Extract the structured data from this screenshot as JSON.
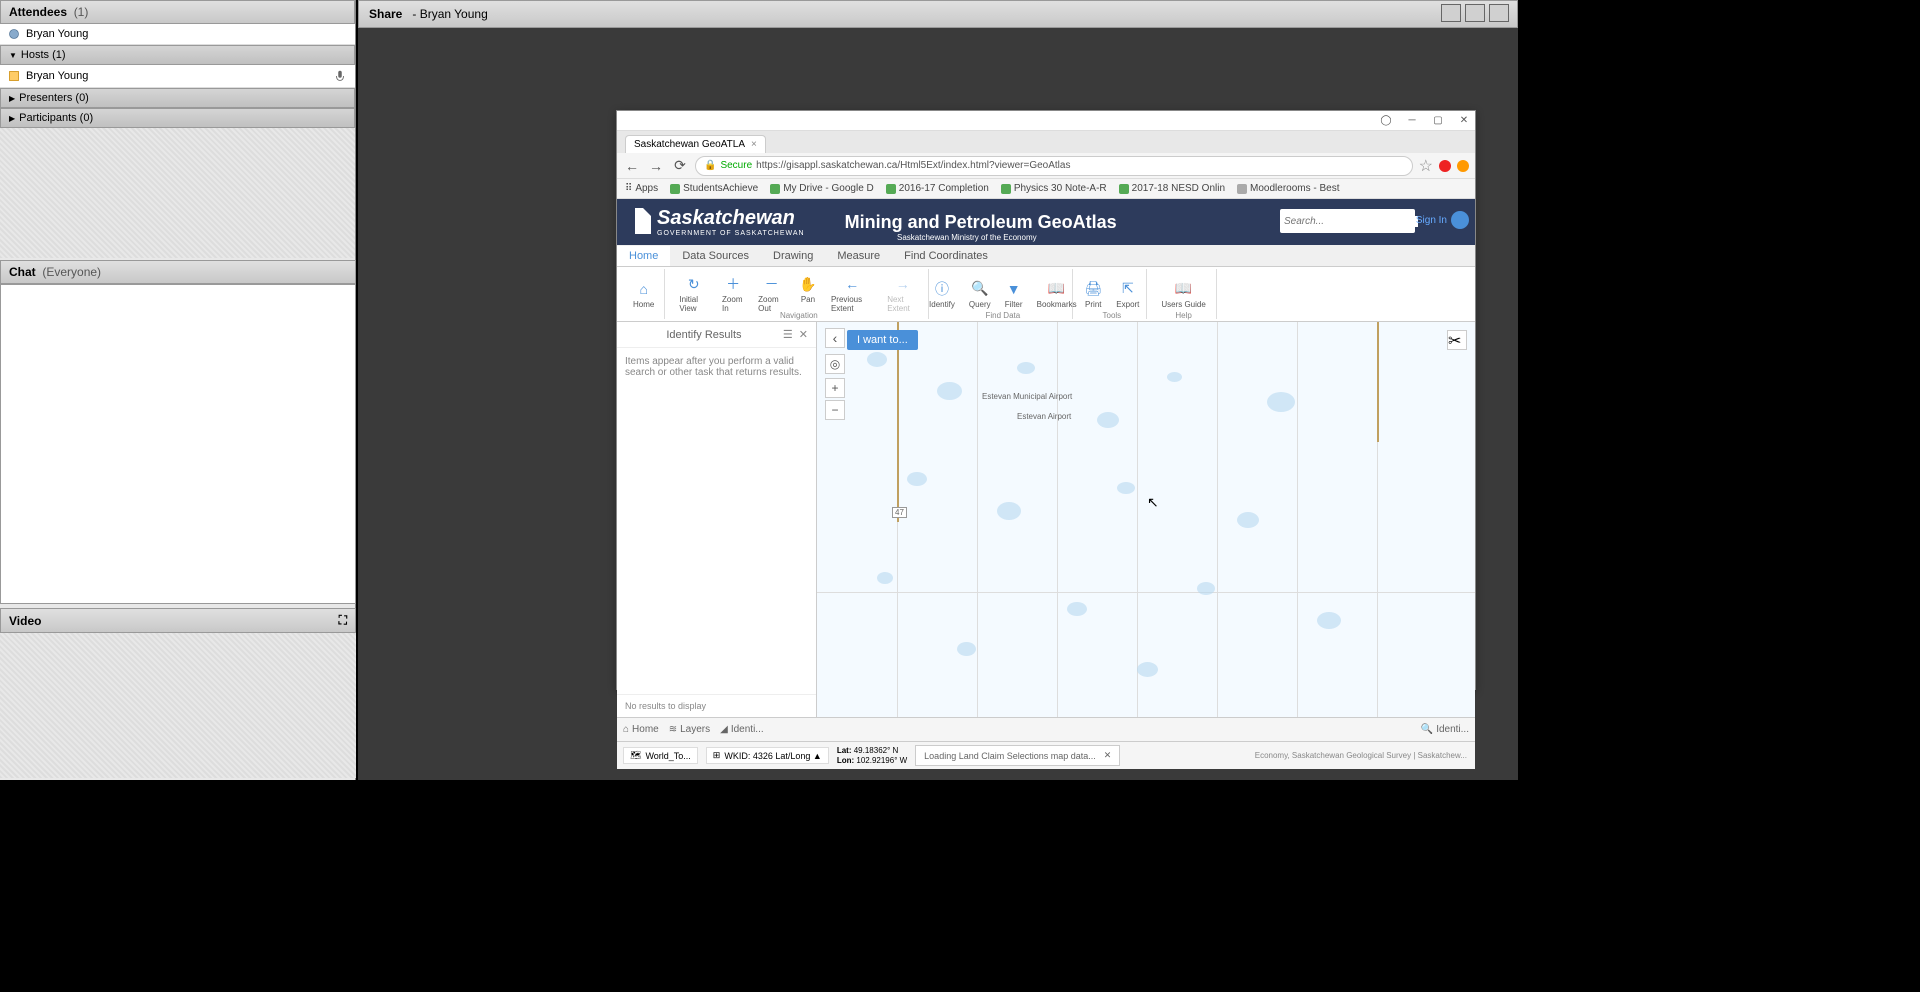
{
  "sidebar": {
    "attendees_label": "Attendees",
    "attendees_count": "(1)",
    "attendee_name": "Bryan Young",
    "hosts_label": "Hosts (1)",
    "host_name": "Bryan Young",
    "presenters_label": "Presenters (0)",
    "participants_label": "Participants (0)",
    "chat_label": "Chat",
    "chat_scope": "(Everyone)",
    "video_label": "Video"
  },
  "share": {
    "label": "Share",
    "presenter": "- Bryan Young"
  },
  "browser": {
    "tab_title": "Saskatchewan GeoATLA",
    "url_secure": "Secure",
    "url": "https://gisappl.saskatchewan.ca/Html5Ext/index.html?viewer=GeoAtlas",
    "bookmarks": [
      "Apps",
      "StudentsAchieve",
      "My Drive - Google D",
      "2016-17 Completion",
      "Physics 30 Note-A-R",
      "2017-18 NESD Onlin",
      "Moodlerooms - Best"
    ]
  },
  "app": {
    "logo": "Saskatchewan",
    "logo_sub": "GOVERNMENT OF SASKATCHEWAN",
    "title": "Mining and Petroleum GeoAtlas",
    "subtitle": "Saskatchewan Ministry of the Economy",
    "search_placeholder": "Search...",
    "signin": "Sign In"
  },
  "ribbon": {
    "tabs": [
      "Home",
      "Data Sources",
      "Drawing",
      "Measure",
      "Find Coordinates"
    ],
    "active": "Home"
  },
  "tools": {
    "home": "Home",
    "initial_view": "Initial View",
    "zoom_in": "Zoom In",
    "zoom_out": "Zoom Out",
    "pan": "Pan",
    "previous_extent": "Previous Extent",
    "next_extent": "Next Extent",
    "identify": "Identify",
    "query": "Query",
    "filter": "Filter",
    "bookmarks": "Bookmarks",
    "print": "Print",
    "export": "Export",
    "users_guide": "Users Guide",
    "group_nav": "Navigation",
    "group_find": "Find Data",
    "group_tools": "Tools",
    "group_help": "Help"
  },
  "identify": {
    "title": "Identify Results",
    "hint": "Items appear after you perform a valid search or other task that returns results.",
    "no_results": "No results to display"
  },
  "map": {
    "iwantto": "I want to...",
    "airport1": "Estevan Municipal Airport",
    "airport2": "Estevan Airport",
    "hwy": "47"
  },
  "bottom_tabs": {
    "home": "Home",
    "layers": "Layers",
    "identify": "Identi...",
    "identify2": "Identi..."
  },
  "status": {
    "basemap": "World_To...",
    "wkid": "WKID: 4326 Lat/Long ▲",
    "lat_label": "Lat:",
    "lat_val": "49.18362° N",
    "lon_label": "Lon:",
    "lon_val": "102.92196° W",
    "loading": "Loading Land Claim Selections map data...",
    "copyright": "Economy, Saskatchewan Geological Survey | Saskatchew..."
  }
}
